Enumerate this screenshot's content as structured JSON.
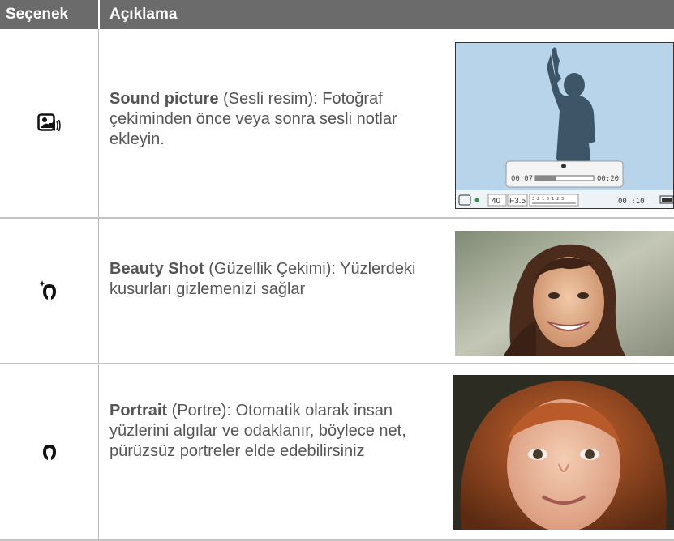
{
  "header": {
    "col_option": "Seçenek",
    "col_description": "Açıklama"
  },
  "rows": [
    {
      "icon": "sound-picture-icon",
      "title": "Sound picture",
      "text": " (Sesli resim): Fotoğraf çekiminden önce veya sonra sesli notlar ekleyin.",
      "screen": {
        "time_start": "00:07",
        "time_end": "00:20",
        "iso": "40",
        "aperture": "F3.5",
        "scale": "3 2 1 0 1 2 3",
        "counter": "00 :10"
      }
    },
    {
      "icon": "beauty-shot-icon",
      "title": "Beauty Shot",
      "text": " (Güzellik Çekimi): Yüzlerdeki kusurları gizlemenizi sağlar"
    },
    {
      "icon": "portrait-icon",
      "title": "Portrait",
      "text": " (Portre): Otomatik olarak insan yüzlerini algılar ve odaklanır, böylece net, pürüzsüz portreler elde edebilirsiniz"
    }
  ]
}
